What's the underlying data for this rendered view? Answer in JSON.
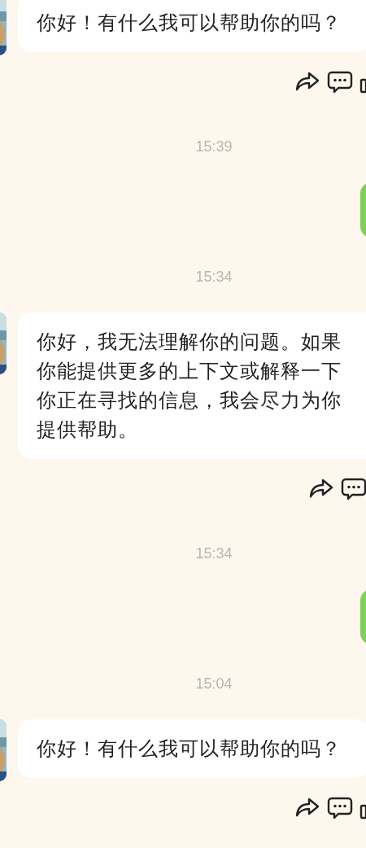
{
  "messages": [
    {
      "kind": "bot",
      "text": "你好！有什么我可以帮助你的吗？"
    },
    {
      "kind": "time",
      "text": "15:39"
    },
    {
      "kind": "user"
    },
    {
      "kind": "time",
      "text": "15:34"
    },
    {
      "kind": "bot",
      "text": "你好，我无法理解你的问题。如果你能提供更多的上下文或解释一下你正在寻找的信息，我会尽力为你提供帮助。"
    },
    {
      "kind": "time",
      "text": "15:34"
    },
    {
      "kind": "user"
    },
    {
      "kind": "time",
      "text": "15:04"
    },
    {
      "kind": "bot",
      "text": "你好！有什么我可以帮助你的吗？"
    }
  ]
}
